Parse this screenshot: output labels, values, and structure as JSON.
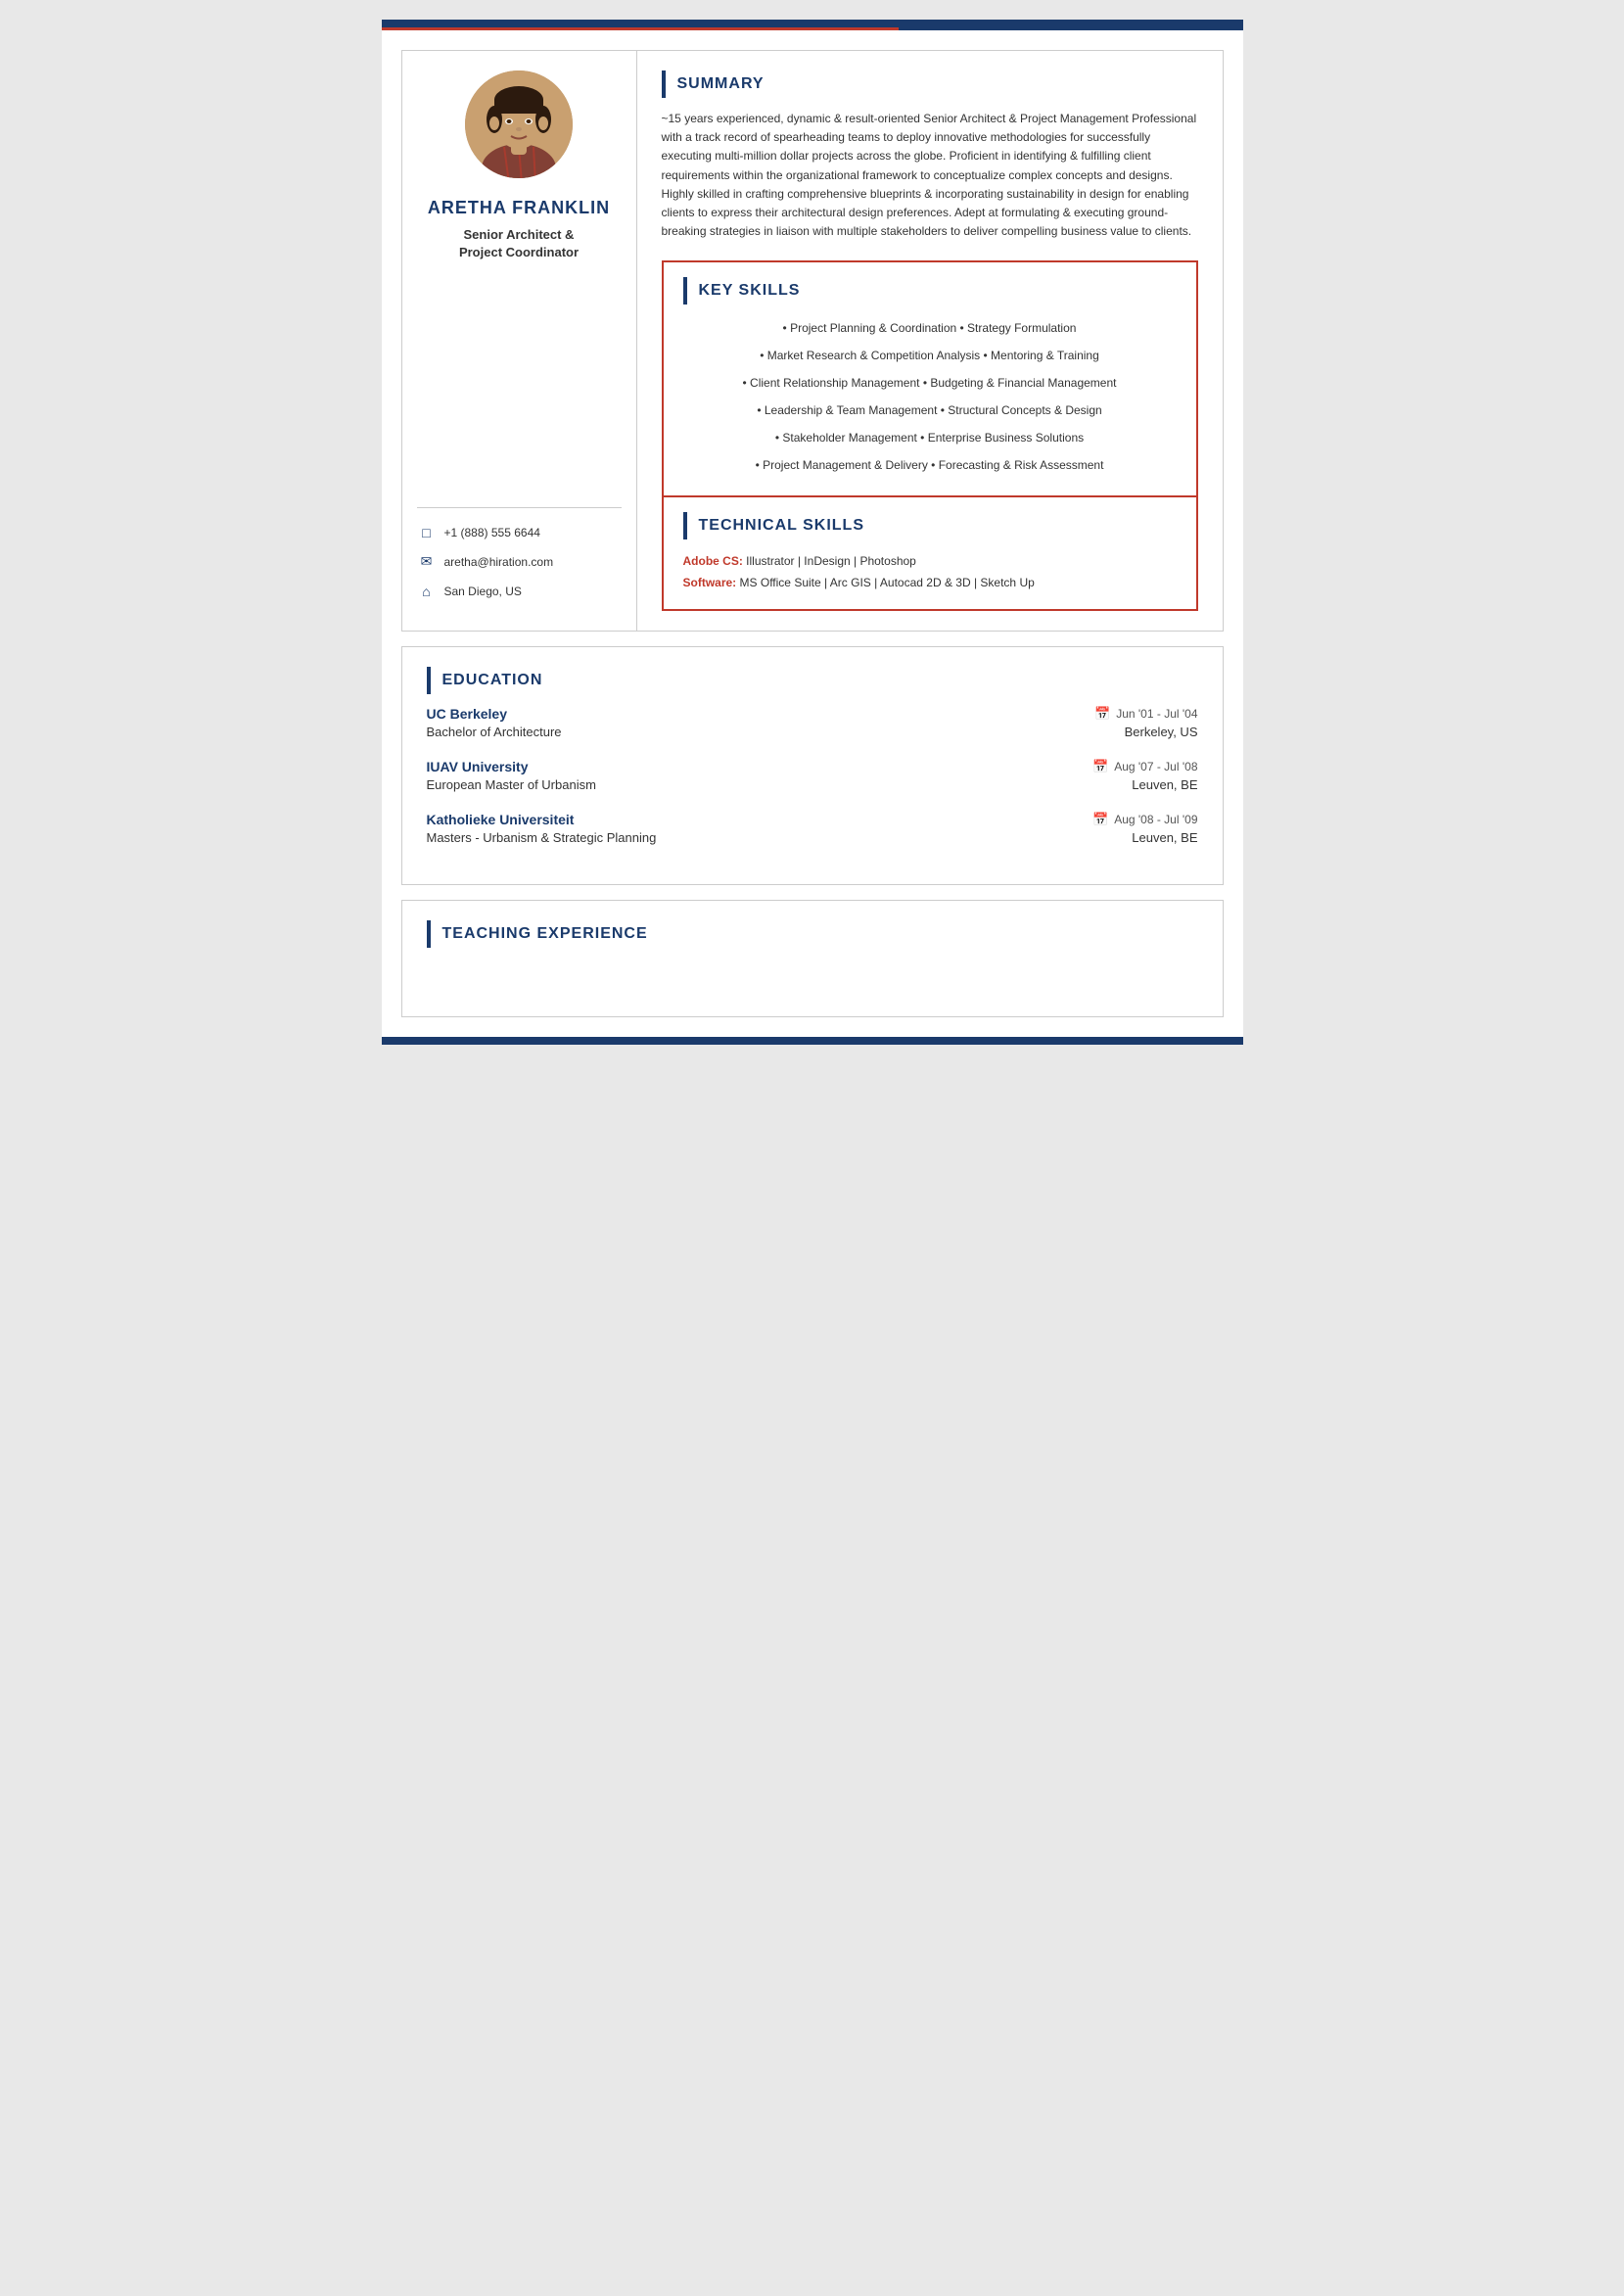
{
  "page": {
    "topBar": "top-accent-bar",
    "bottomBar": "bottom-accent-bar"
  },
  "sidebar": {
    "name": "ARETHA FRANKLiN",
    "title_line1": "Senior Architect &",
    "title_line2": "Project Coordinator",
    "contact": {
      "phone": "+1 (888) 555 6644",
      "email": "aretha@hiration.com",
      "location": "San Diego, US"
    }
  },
  "summary": {
    "section_label": "SUMMARY",
    "text": "~15 years experienced, dynamic & result-oriented Senior Architect & Project Management Professional with a track record of spearheading teams to deploy innovative methodologies for successfully executing multi-million dollar projects across the globe. Proficient in identifying & fulfilling client requirements within the organizational framework to conceptualize complex concepts and designs. Highly skilled in crafting comprehensive blueprints & incorporating sustainability in design for enabling clients to express their architectural design preferences. Adept at formulating & executing ground-breaking strategies in liaison with multiple stakeholders to deliver compelling business value to clients."
  },
  "keySkills": {
    "section_label": "KEY SKILLS",
    "skills": [
      "• Project Planning & Coordination • Strategy Formulation",
      "• Market Research & Competition Analysis • Mentoring & Training",
      "• Client Relationship Management • Budgeting & Financial Management",
      "• Leadership & Team Management • Structural Concepts & Design",
      "• Stakeholder Management • Enterprise Business Solutions",
      "• Project Management & Delivery • Forecasting & Risk Assessment"
    ]
  },
  "technicalSkills": {
    "section_label": "TECHNICAL SKILLS",
    "adobeLabel": "Adobe CS:",
    "adobeValue": " Illustrator | InDesign | Photoshop",
    "softwareLabel": "Software:",
    "softwareValue": " MS Office Suite | Arc GIS | Autocad 2D & 3D | Sketch Up"
  },
  "education": {
    "section_label": "EDUCATION",
    "entries": [
      {
        "institution": "UC Berkeley",
        "date": "Jun '01 -  Jul '04",
        "degree": "Bachelor of Architecture",
        "location": "Berkeley, US"
      },
      {
        "institution": "IUAV University",
        "date": "Aug '07 -  Jul '08",
        "degree": "European Master of Urbanism",
        "location": "Leuven, BE"
      },
      {
        "institution": "Katholieke Universiteit",
        "date": "Aug '08 -  Jul '09",
        "degree": "Masters - Urbanism & Strategic Planning",
        "location": "Leuven, BE"
      }
    ]
  },
  "teachingExperience": {
    "section_label": "TEACHING EXPERIENCE"
  }
}
